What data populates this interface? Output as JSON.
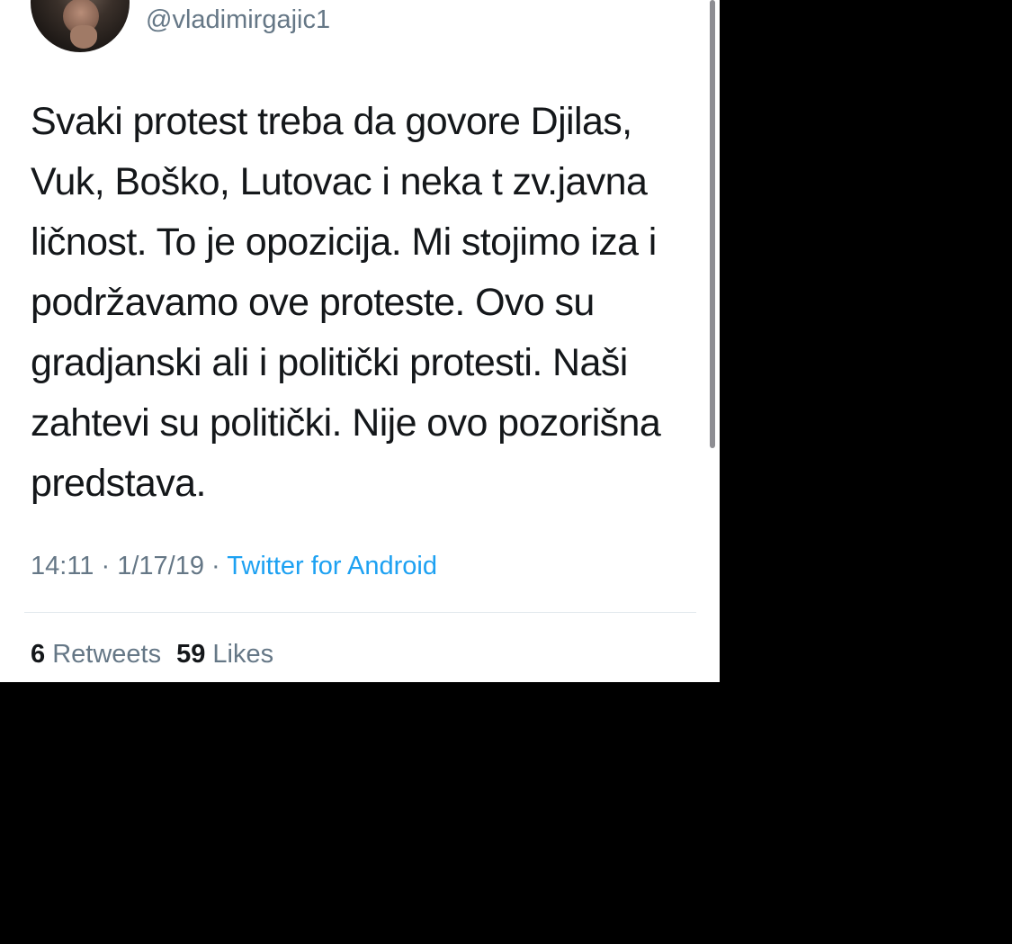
{
  "tweet": {
    "handle": "@vladimirgajic1",
    "text_lines": [
      "Svaki protest treba da govore Djilas,",
      "Vuk, Boško, Lutovac i neka t zv.javna",
      "ličnost. To je opozicija. Mi stojimo iza i",
      "podržavamo ove proteste. Ovo su",
      "gradjanski ali i politički protesti. Naši",
      "zahtevi su politički. Nije ovo pozorišna",
      "predstava."
    ],
    "time": "14:11",
    "separator": "·",
    "date": "1/17/19",
    "source": "Twitter for Android"
  },
  "stats": {
    "retweets_count": "6",
    "retweets_label": "Retweets",
    "likes_count": "59",
    "likes_label": "Likes"
  },
  "colors": {
    "text": "#14171a",
    "secondary": "#657786",
    "link": "#1da1f2",
    "divider": "#e1e8ed",
    "background": "#000000"
  }
}
